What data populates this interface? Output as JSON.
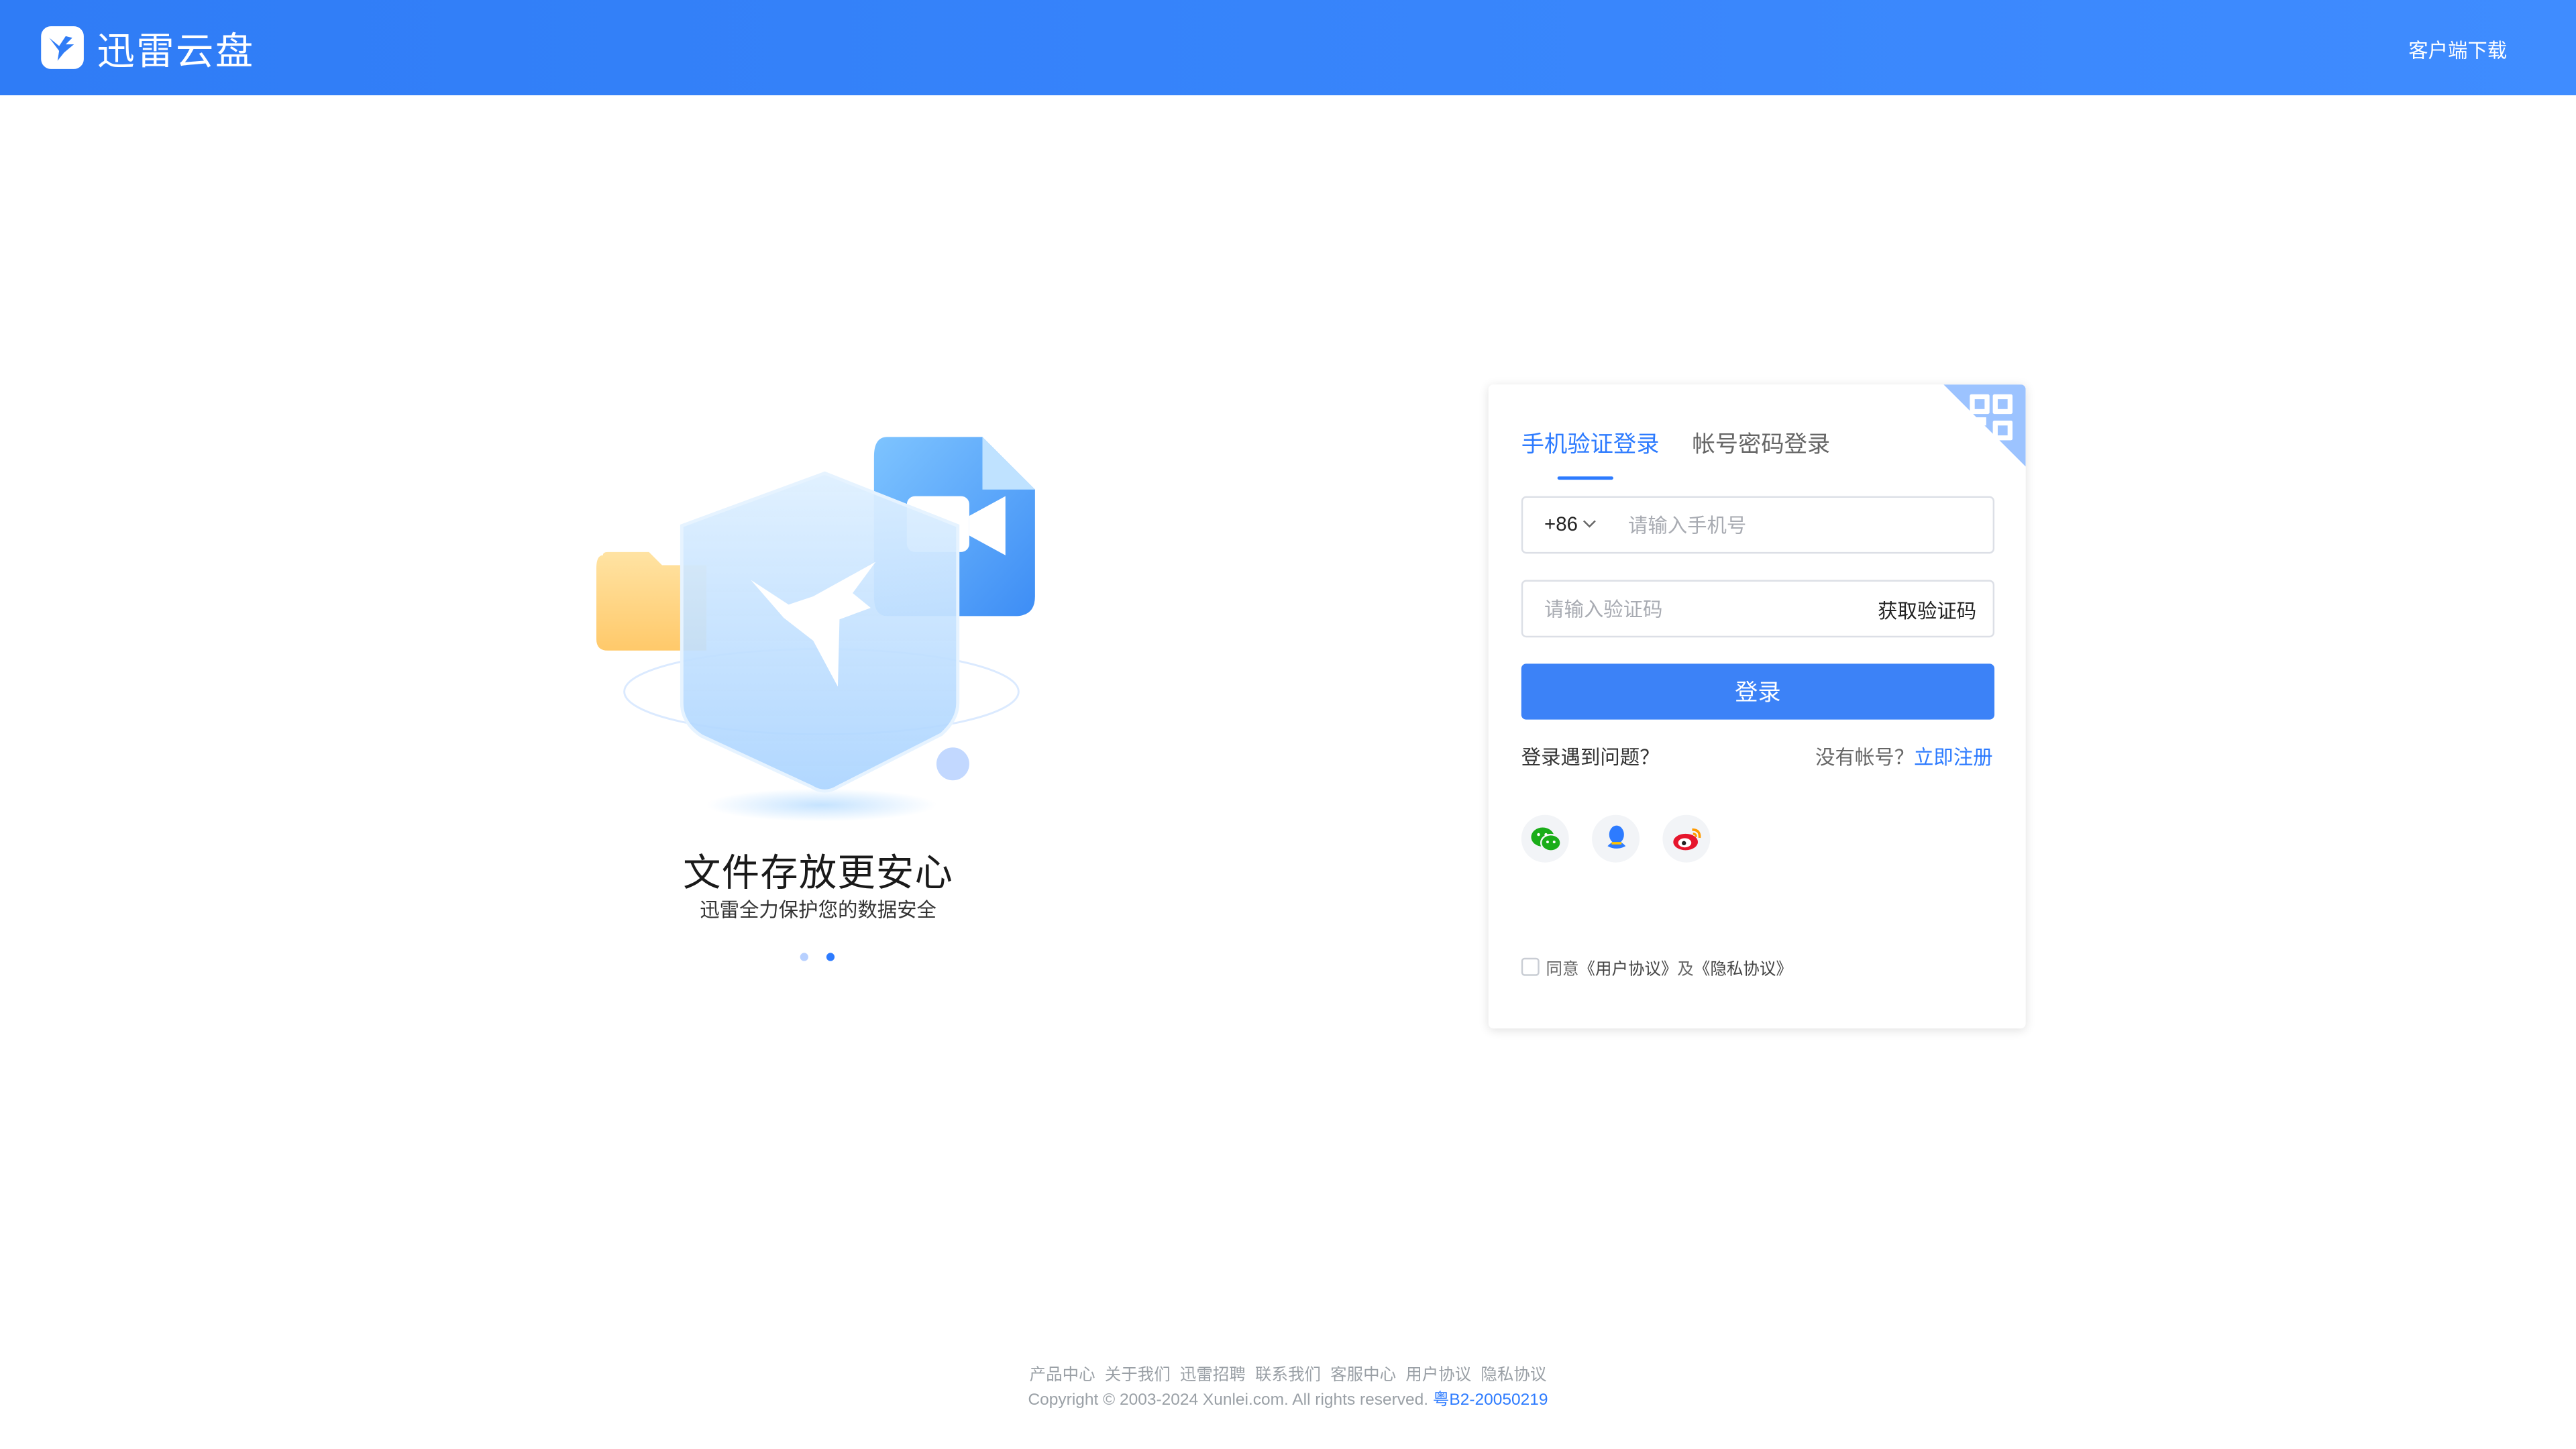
{
  "header": {
    "brand_name": "迅雷云盘",
    "client_download": "客户端下载"
  },
  "promo": {
    "title": "文件存放更安心",
    "subtitle": "迅雷全力保护您的数据安全",
    "slides_count": 2,
    "active_slide": 2
  },
  "login": {
    "tabs": [
      {
        "label": "手机验证登录",
        "active": true
      },
      {
        "label": "帐号密码登录",
        "active": false
      }
    ],
    "country_code": "+86",
    "phone_placeholder": "请输入手机号",
    "code_placeholder": "请输入验证码",
    "get_code": "获取验证码",
    "login_button": "登录",
    "help": "登录遇到问题？",
    "no_account": "没有帐号？",
    "register": "立即注册",
    "socials": [
      "wechat-icon",
      "qq-icon",
      "weibo-icon"
    ],
    "agree_prefix": "同意",
    "user_agreement": "《用户协议》",
    "and": "及",
    "privacy_agreement": "《隐私协议》"
  },
  "footer": {
    "links": [
      "产品中心",
      "关于我们",
      "迅雷招聘",
      "联系我们",
      "客服中心",
      "用户协议",
      "隐私协议"
    ],
    "copyright": "Copyright © 2003-2024 Xunlei.com. All rights reserved.",
    "icp": "粤B2-20050219"
  },
  "colors": {
    "brand_blue": "#2f7cf6",
    "link_blue": "#2d7bff",
    "button_blue": "#3c82f7"
  }
}
